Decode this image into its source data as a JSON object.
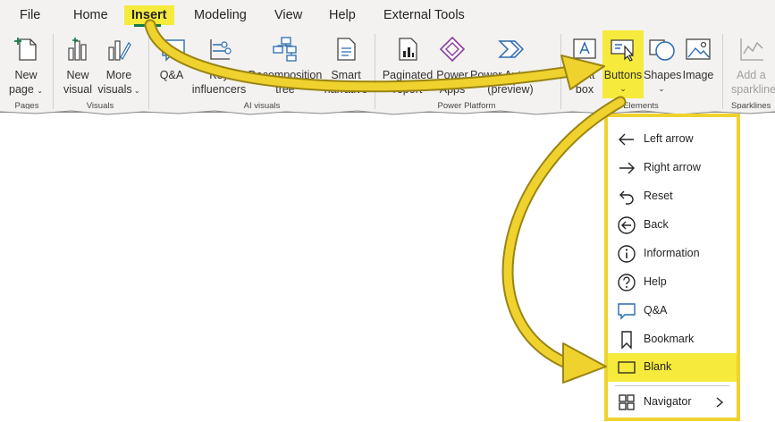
{
  "menu": {
    "file": "File",
    "home": "Home",
    "insert": "Insert",
    "modeling": "Modeling",
    "view": "View",
    "help": "Help",
    "external_tools": "External Tools"
  },
  "ribbon": {
    "new_page": {
      "line1": "New",
      "line2": "page"
    },
    "new_visual": {
      "line1": "New",
      "line2": "visual"
    },
    "more_visuals": {
      "line1": "More",
      "line2": "visuals"
    },
    "qa": "Q&A",
    "key_influencers": {
      "line1": "Key",
      "line2": "influencers"
    },
    "decomposition_tree": {
      "line1": "Decomposition",
      "line2": "tree"
    },
    "smart_narrative": {
      "line1": "Smart",
      "line2": "narrative"
    },
    "paginated_report": {
      "line1": "Paginated",
      "line2": "report"
    },
    "power_apps": {
      "line1": "Power",
      "line2": "Apps"
    },
    "power_automate": {
      "line1": "Power Automate",
      "line2": "(preview)"
    },
    "text_box": {
      "line1": "Text",
      "line2": "box"
    },
    "buttons": "Buttons",
    "shapes": "Shapes",
    "image": "Image",
    "add_sparkline": {
      "line1": "Add a",
      "line2": "sparkline"
    },
    "groups": {
      "pages": "Pages",
      "visuals": "Visuals",
      "ai_visuals": "AI visuals",
      "power_platform": "Power Platform",
      "elements": "Elements",
      "sparklines": "Sparklines"
    }
  },
  "dropdown": {
    "items": [
      {
        "label": "Left arrow",
        "icon": "left-arrow-icon"
      },
      {
        "label": "Right arrow",
        "icon": "right-arrow-icon"
      },
      {
        "label": "Reset",
        "icon": "reset-icon"
      },
      {
        "label": "Back",
        "icon": "back-icon"
      },
      {
        "label": "Information",
        "icon": "information-icon"
      },
      {
        "label": "Help",
        "icon": "help-icon"
      },
      {
        "label": "Q&A",
        "icon": "qa-bubble-icon"
      },
      {
        "label": "Bookmark",
        "icon": "bookmark-icon"
      },
      {
        "label": "Blank",
        "icon": "blank-icon"
      },
      {
        "label": "Navigator",
        "icon": "navigator-icon"
      }
    ]
  },
  "colors": {
    "highlight": "#f6ea3c",
    "arrow": "#f0d22e",
    "arrow_outline": "#9a8412",
    "ribbon_bg": "#f3f2f1",
    "accent_green": "#107c41"
  }
}
